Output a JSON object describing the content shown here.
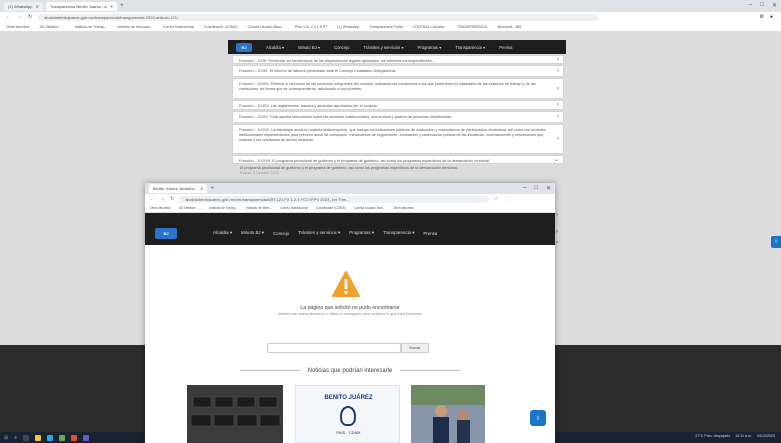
{
  "bg_browser": {
    "tabs": [
      "(1) WhatsApp",
      "Transparencia Benito Juárez - A"
    ],
    "url": "alcaldiabenitojuarez.gob.mx/transparencia/transparencia-2023-articulo-121/",
    "bookmarks": [
      "Otros favoritos",
      "AG Medidor - ...",
      "Instituto de Transp...",
      "Instituto de Mercado...",
      "Correo Institucional",
      "Coordinador (CDMX)",
      "Cuenta Usuario Banc...",
      "Piso 3 AL 2.4 1.5 PT",
      "(1) WhatsApp",
      "Transparencia Portal",
      "CONTRAL / Acceso...",
      "TRANSPARENCIA",
      "Microsoft - 365"
    ],
    "side_button": "i"
  },
  "site": {
    "logo": "BJ",
    "nav": [
      "Alcaldía ▾",
      "Minuto BJ ▾",
      "Concejo",
      "Trámites y servicios ▾",
      "Programas ▾",
      "Transparencia ▾",
      "Prensa"
    ]
  },
  "accordion": [
    "Fracción – XXXI. Presentar, en los términos de las disposiciones legales aplicables, los informes correspondientes...",
    "Fracción – XXXII. El informe de labores presentado ante el Consejo Ciudadano Delegacional.",
    "Fracción – XXXIII. Publicar el directorio de las personas integrantes del consejo, indicando las comisiones a las que pertenecen el calendario de las sesiones de trabajo y de las comisiones, de forma que se correspondiente, adicionado a los informes.",
    "Fracción – XXXIV. Los reglamentos, bandos y acuerdos aprobados por el consejo.",
    "Fracción – XXXV. Toda aquella información sobre las acciones institucionales, sus montos y padrón de personas beneficiarias.",
    "Fracción – XXXVI. La estrategia anual en materia anticorrupción, que incluya los indicadores públicos de evaluación y mecanismos de participación ciudadana, así como los controles institucionales implementados para prevenir actos de corrupción, mecanismos de seguimiento, evaluación y observación pública de las iniciativas, contrataciones y concesiones que realicen y los resultados de dichos sistemas.",
    "Fracción – XXXVII. El programa provisional de gobierno y el programa de gobierno, así como los programas específicos de la demarcación territorial."
  ],
  "accordion_open_text": "El programa provisional de gobierno y el programa de gobierno, así como los programas específicos de la demarcación territorial.",
  "accordion_open_date": "Fecha: 3 Octubre 2023",
  "fg_browser": {
    "tab": "Benito Juárez, Alcaldía...",
    "url": "alcaldiabenitojuarez.gob.mx/ver/transparencia/ART.121 FX 1.2.4 FCCYFPV 2023_1er Trim...",
    "bookmarks": [
      "Otros favoritos",
      "AG Medidor - ...",
      "Instituto de Transp...",
      "Instituto de Merc...",
      "Correo Institucional",
      "Coordinador (CDMX)",
      "Cuenta Usuario Ban...",
      "Otros favoritos"
    ]
  },
  "error": {
    "title": "La página que solicitó no pudo encontrarse",
    "subtitle": "Intente una nueva dirección o utilice el navegador para localizar lo que está buscando",
    "search_button": "Buscar",
    "news_heading": "Noticias que podrían interesarle",
    "news2_brand": "BENITO JUÁREZ",
    "news2_tag": "PAÍS · CDMX"
  },
  "taskbar": {
    "weather": "27°C Pres. despejado",
    "time": "10:11 a.m.",
    "date": "03/10/2023"
  },
  "colors": {
    "accent": "#1877c9",
    "dark": "#1e1e1e",
    "warning": "#f0a030"
  }
}
